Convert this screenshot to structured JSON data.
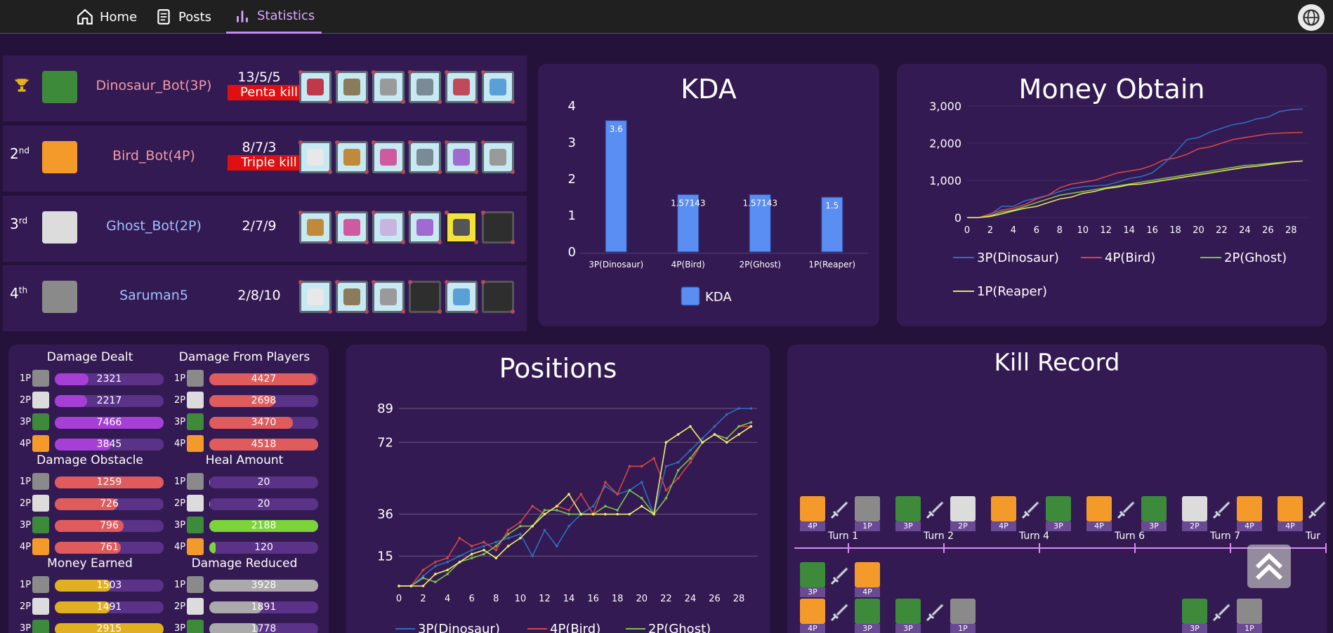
{
  "nav": {
    "items": [
      {
        "label": "Home",
        "icon": "home-icon"
      },
      {
        "label": "Posts",
        "icon": "document-icon"
      },
      {
        "label": "Statistics",
        "icon": "bar-chart-icon",
        "active": true
      }
    ]
  },
  "players": [
    {
      "rank": "",
      "rank_icon": "trophy-icon",
      "name": "Dinosaur_Bot(3P)",
      "name_color": "#f29aa6",
      "kda": "13/5/5",
      "kill_badge": "Penta kill",
      "avatar_color": "#3c8a3a",
      "items": [
        "raspberry",
        "shield-sword",
        "chain",
        "crossed-swords",
        "crossed-swords-red",
        "sword"
      ]
    },
    {
      "rank": "2",
      "rank_suffix": "nd",
      "name": "Bird_Bot(4P)",
      "name_color": "#f29aa6",
      "kda": "8/7/3",
      "kill_badge": "Triple kill",
      "avatar_color": "#f39a2a",
      "items": [
        "armor-wings",
        "bag",
        "potion",
        "crossed-swords",
        "orb",
        "chain"
      ]
    },
    {
      "rank": "3",
      "rank_suffix": "rd",
      "name": "Ghost_Bot(2P)",
      "name_color": "#9ec3ff",
      "kda": "2/7/9",
      "kill_badge": "",
      "avatar_color": "#dcdcdc",
      "items": [
        "bag",
        "potion",
        "robe",
        "orb",
        "axe",
        "empty"
      ]
    },
    {
      "rank": "4",
      "rank_suffix": "th",
      "name": "Saruman5",
      "name_color": "#9ec3ff",
      "kda": "2/8/10",
      "kill_badge": "",
      "avatar_color": "#8a8a8a",
      "items": [
        "armor-wings",
        "shield-sword",
        "chain",
        "empty",
        "sword",
        "empty"
      ]
    }
  ],
  "kda_panel": {
    "title": "KDA",
    "chart_data": {
      "type": "bar",
      "categories": [
        "3P(Dinosaur)",
        "4P(Bird)",
        "2P(Ghost)",
        "1P(Reaper)"
      ],
      "values": [
        3.6,
        1.57143,
        1.57143,
        1.5
      ],
      "value_labels": [
        "3.6",
        "1.57143",
        "1.57143",
        "1.5"
      ],
      "y_ticks": [
        "0",
        "1",
        "2",
        "3",
        "4"
      ],
      "ylim": [
        0,
        4
      ],
      "legend": [
        "KDA"
      ],
      "color": "#5b8ef2"
    }
  },
  "money_panel": {
    "title": "Money Obtain",
    "chart_data": {
      "type": "line",
      "x": [
        0,
        1,
        2,
        3,
        4,
        5,
        6,
        7,
        8,
        9,
        10,
        11,
        12,
        13,
        14,
        15,
        16,
        17,
        18,
        19,
        20,
        21,
        22,
        23,
        24,
        25,
        26,
        27,
        28,
        29
      ],
      "x_ticks": [
        "0",
        "2",
        "4",
        "6",
        "8",
        "10",
        "12",
        "14",
        "16",
        "18",
        "20",
        "22",
        "24",
        "26",
        "28"
      ],
      "y_ticks": [
        "0",
        "1,000",
        "2,000",
        "3,000"
      ],
      "ylim": [
        0,
        3000
      ],
      "series": [
        {
          "name": "3P(Dinosaur)",
          "color": "#2d6fbf",
          "values": [
            0,
            0,
            80,
            300,
            300,
            450,
            520,
            600,
            700,
            780,
            830,
            850,
            870,
            950,
            1050,
            1100,
            1200,
            1450,
            1750,
            2100,
            2150,
            2300,
            2400,
            2500,
            2550,
            2650,
            2700,
            2850,
            2900,
            2920
          ]
        },
        {
          "name": "4P(Bird)",
          "color": "#d64545",
          "values": [
            0,
            0,
            100,
            200,
            250,
            350,
            500,
            600,
            800,
            900,
            950,
            1000,
            1100,
            1200,
            1250,
            1300,
            1400,
            1550,
            1600,
            1700,
            1850,
            1900,
            2000,
            2100,
            2150,
            2200,
            2250,
            2270,
            2280,
            2290
          ]
        },
        {
          "name": "2P(Ghost)",
          "color": "#79c24a",
          "values": [
            0,
            0,
            50,
            150,
            200,
            300,
            400,
            500,
            600,
            650,
            700,
            750,
            800,
            850,
            900,
            950,
            1000,
            1050,
            1100,
            1150,
            1200,
            1250,
            1300,
            1350,
            1400,
            1420,
            1450,
            1480,
            1500,
            1520
          ]
        },
        {
          "name": "1P(Reaper)",
          "color": "#e6e35a",
          "values": [
            0,
            0,
            30,
            100,
            180,
            250,
            300,
            400,
            500,
            550,
            650,
            700,
            780,
            820,
            880,
            900,
            950,
            1000,
            1050,
            1100,
            1150,
            1200,
            1250,
            1300,
            1350,
            1380,
            1420,
            1460,
            1500,
            1520
          ]
        }
      ]
    }
  },
  "damage_stats": [
    {
      "title": "Damage Dealt",
      "color": "#a63fd6",
      "max": 7466,
      "rows": [
        {
          "p": "1P",
          "v": 2321,
          "label": "2321"
        },
        {
          "p": "2P",
          "v": 2217,
          "label": "2217"
        },
        {
          "p": "3P",
          "v": 7466,
          "label": "7466"
        },
        {
          "p": "4P",
          "v": 3845,
          "label": "3845"
        }
      ]
    },
    {
      "title": "Damage From Players",
      "color": "#e05c5c",
      "max": 4518,
      "rows": [
        {
          "p": "1P",
          "v": 4427,
          "label": "4427"
        },
        {
          "p": "2P",
          "v": 2698,
          "label": "2698"
        },
        {
          "p": "3P",
          "v": 3470,
          "label": "3470"
        },
        {
          "p": "4P",
          "v": 4518,
          "label": "4518"
        }
      ]
    },
    {
      "title": "Damage Obstacle",
      "color": "#e05c5c",
      "max": 1259,
      "rows": [
        {
          "p": "1P",
          "v": 1259,
          "label": "1259"
        },
        {
          "p": "2P",
          "v": 726,
          "label": "726"
        },
        {
          "p": "3P",
          "v": 796,
          "label": "796"
        },
        {
          "p": "4P",
          "v": 761,
          "label": "761"
        }
      ]
    },
    {
      "title": "Heal Amount",
      "color": "#7ad43a",
      "max": 2188,
      "rows": [
        {
          "p": "1P",
          "v": 20,
          "label": "20"
        },
        {
          "p": "2P",
          "v": 20,
          "label": "20"
        },
        {
          "p": "3P",
          "v": 2188,
          "label": "2188"
        },
        {
          "p": "4P",
          "v": 120,
          "label": "120"
        }
      ]
    },
    {
      "title": "Money Earned",
      "color": "#e0b020",
      "max": 2915,
      "rows": [
        {
          "p": "1P",
          "v": 1503,
          "label": "1503"
        },
        {
          "p": "2P",
          "v": 1491,
          "label": "1491"
        },
        {
          "p": "3P",
          "v": 2915,
          "label": "2915"
        }
      ]
    },
    {
      "title": "Damage Reduced",
      "color": "#aaaaaa",
      "max": 3928,
      "rows": [
        {
          "p": "1P",
          "v": 3928,
          "label": "3928"
        },
        {
          "p": "2P",
          "v": 1891,
          "label": "1891"
        },
        {
          "p": "3P",
          "v": 1778,
          "label": "1778"
        }
      ]
    }
  ],
  "positions_panel": {
    "title": "Positions",
    "chart_data": {
      "type": "line",
      "x": [
        0,
        1,
        2,
        3,
        4,
        5,
        6,
        7,
        8,
        9,
        10,
        11,
        12,
        13,
        14,
        15,
        16,
        17,
        18,
        19,
        20,
        21,
        22,
        23,
        24,
        25,
        26,
        27,
        28,
        29
      ],
      "x_ticks": [
        "0",
        "2",
        "4",
        "6",
        "8",
        "10",
        "12",
        "14",
        "16",
        "18",
        "20",
        "22",
        "24",
        "26",
        "28"
      ],
      "y_ticks": [
        "15",
        "36",
        "72",
        "89"
      ],
      "ylim": [
        0,
        89
      ],
      "legend": [
        "3P(Dinosaur)",
        "4P(Bird)",
        "2P(Ghost)"
      ],
      "series": [
        {
          "name": "3P(Dinosaur)",
          "color": "#2d6fbf",
          "values": [
            0,
            0,
            5,
            10,
            12,
            15,
            18,
            20,
            22,
            24,
            26,
            15,
            28,
            20,
            30,
            36,
            40,
            50,
            46,
            48,
            52,
            36,
            60,
            62,
            68,
            74,
            80,
            86,
            89,
            89
          ]
        },
        {
          "name": "4P(Bird)",
          "color": "#d64545",
          "values": [
            0,
            0,
            8,
            12,
            14,
            24,
            20,
            22,
            18,
            28,
            32,
            40,
            36,
            40,
            38,
            46,
            36,
            52,
            46,
            60,
            60,
            64,
            48,
            54,
            62,
            72,
            76,
            74,
            80,
            80
          ]
        },
        {
          "name": "2P(Ghost)",
          "color": "#79c24a",
          "values": [
            0,
            0,
            4,
            2,
            6,
            12,
            14,
            16,
            20,
            26,
            30,
            30,
            38,
            38,
            36,
            36,
            36,
            40,
            38,
            48,
            44,
            36,
            44,
            58,
            64,
            72,
            76,
            74,
            80,
            82
          ]
        },
        {
          "name": "1P(Reaper)",
          "color": "#f2ee6a",
          "values": [
            0,
            0,
            0,
            6,
            8,
            12,
            16,
            18,
            14,
            20,
            24,
            30,
            36,
            40,
            46,
            36,
            36,
            36,
            36,
            36,
            40,
            36,
            72,
            76,
            80,
            72,
            76,
            72,
            76,
            80
          ]
        }
      ]
    }
  },
  "kill_record": {
    "title": "Kill Record",
    "turns": [
      "Turn 1",
      "Turn 2",
      "Turn 4",
      "Turn 6",
      "Turn 7",
      "Tur"
    ],
    "kills_row1": [
      {
        "killer": "4P",
        "victim": "1P"
      },
      {
        "killer": "3P",
        "victim": "2P"
      },
      {
        "killer": "4P",
        "victim": "3P"
      },
      {
        "killer": "4P",
        "victim": "3P"
      },
      {
        "killer": "2P",
        "victim": "4P"
      },
      {
        "killer": "4P",
        "victim": ""
      }
    ],
    "kills_row2": [
      {
        "killer": "3P",
        "victim": "4P"
      }
    ],
    "kills_row3": [
      {
        "killer": "4P",
        "victim": "3P"
      },
      {
        "killer": "3P",
        "victim": "1P"
      },
      {
        "killer": "3P",
        "victim": "1P"
      }
    ]
  },
  "colors": {
    "background": "#24123a",
    "panel": "#341a52",
    "player_1P": "#8a8a8a",
    "player_2P": "#dcdcdc",
    "player_3P": "#3c8a3a",
    "player_4P": "#f39a2a"
  }
}
